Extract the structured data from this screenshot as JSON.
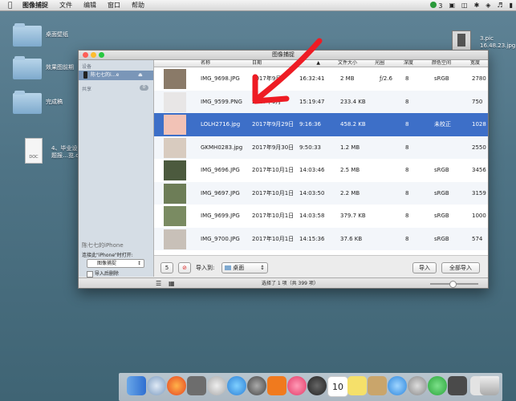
{
  "menubar": {
    "apple": "",
    "items": [
      "图像捕捉",
      "文件",
      "编辑",
      "窗口",
      "帮助"
    ],
    "status_count": "3"
  },
  "desktop": {
    "folders": [
      {
        "label": "桌面壁纸"
      },
      {
        "label": "效果图前期"
      },
      {
        "label": "完成稿"
      }
    ],
    "doc": {
      "label_line1": "4、毕业设",
      "label_line2": "题报…览.d",
      "ext": "DOC"
    },
    "file_right": {
      "label_line1": "3.pic",
      "label_line2": "16.48.23.jpg"
    }
  },
  "window": {
    "title": "图像捕捉",
    "sidebar": {
      "devices_header": "设备",
      "device_name": "陈七七的i…e",
      "shared_header": "共享",
      "shared_count": "0",
      "device_footer": "陈七七的iPhone",
      "open_with_label": "连接此\"iPhone\"时打开:",
      "open_with_value": "图像捕捉",
      "delete_after_import": "导入后删除"
    },
    "columns": [
      "名称",
      "日期",
      "文件大小",
      "光圈",
      "深度",
      "颜色空间",
      "宽度"
    ],
    "rows": [
      {
        "name": "IMG_9698.JPG",
        "date": "2017年9月",
        "time": "16:32:41",
        "size": "2 MB",
        "aperture": "ƒ/2.6",
        "depth": "8",
        "color": "sRGB",
        "width": "2780"
      },
      {
        "name": "IMG_9599.PNG",
        "date": "2017年9月",
        "time": "15:19:47",
        "size": "233.4 KB",
        "aperture": "",
        "depth": "8",
        "color": "",
        "width": "750"
      },
      {
        "name": "LOLH2716.jpg",
        "date": "2017年9月29日",
        "time": "9:16:36",
        "size": "458.2 KB",
        "aperture": "",
        "depth": "8",
        "color": "未校正",
        "width": "1028"
      },
      {
        "name": "GKMH0283.jpg",
        "date": "2017年9月30日",
        "time": "9:50:33",
        "size": "1.2 MB",
        "aperture": "",
        "depth": "8",
        "color": "",
        "width": "2550"
      },
      {
        "name": "IMG_9696.JPG",
        "date": "2017年10月1日",
        "time": "14:03:46",
        "size": "2.5 MB",
        "aperture": "",
        "depth": "8",
        "color": "sRGB",
        "width": "3456"
      },
      {
        "name": "IMG_9697.JPG",
        "date": "2017年10月1日",
        "time": "14:03:50",
        "size": "2.2 MB",
        "aperture": "",
        "depth": "8",
        "color": "sRGB",
        "width": "3159"
      },
      {
        "name": "IMG_9699.JPG",
        "date": "2017年10月1日",
        "time": "14:03:58",
        "size": "379.7 KB",
        "aperture": "",
        "depth": "8",
        "color": "sRGB",
        "width": "1000"
      },
      {
        "name": "IMG_9700.JPG",
        "date": "2017年10月1日",
        "time": "14:15:36",
        "size": "37.6 KB",
        "aperture": "",
        "depth": "8",
        "color": "sRGB",
        "width": "574"
      }
    ],
    "footer": {
      "count_button": "5",
      "import_to_label": "导入到:",
      "destination": "桌面",
      "import_button": "导入",
      "import_all_button": "全部导入"
    },
    "status": "选择了 1 项（共 399 项）"
  },
  "dock": {
    "calendar_day": "10"
  },
  "colors": {
    "selection": "#3d6fc8",
    "arrow": "#ee1c24",
    "desktop": "#55798c"
  }
}
